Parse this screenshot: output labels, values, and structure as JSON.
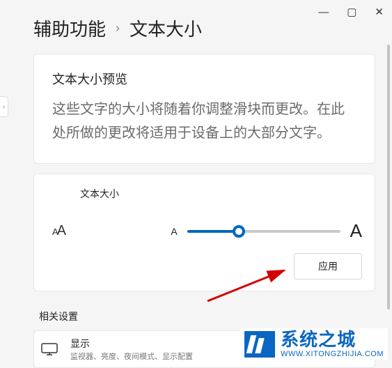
{
  "window": {
    "min": "—",
    "max": "▢",
    "close": "✕"
  },
  "breadcrumb": {
    "parent": "辅助功能",
    "sep": "›",
    "current": "文本大小"
  },
  "preview": {
    "title": "文本大小预览",
    "body": "这些文字的大小将随着你调整滑块而更改。在此处所做的更改将适用于设备上的大部分文字。"
  },
  "slider": {
    "label": "文本大小",
    "min_letter": "A",
    "max_letter": "A",
    "value_percent": 34
  },
  "apply_label": "应用",
  "related_section": "相关设置",
  "display_item": {
    "title": "显示",
    "subtitle": "监视器、亮度、夜间模式、显示配置"
  },
  "watermark": {
    "name": "系统之城",
    "url": "WWW.XITONGZHIJIA.COM"
  }
}
